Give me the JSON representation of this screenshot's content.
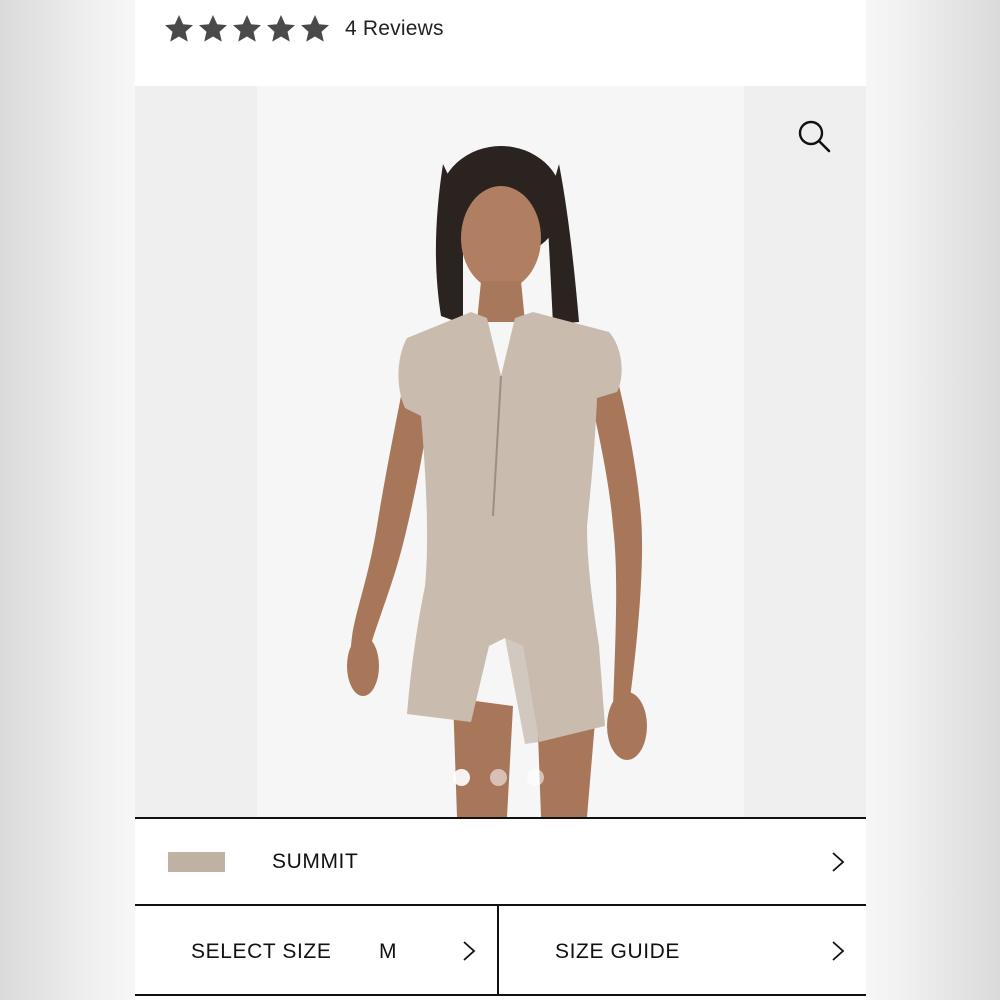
{
  "rating": {
    "stars": 5,
    "reviews_label": "4 Reviews"
  },
  "gallery": {
    "zoom_icon": "search-icon",
    "dot_count": 3,
    "active_dot": 1
  },
  "colour": {
    "label": "SUMMIT",
    "swatch_color": "#bfb2a3"
  },
  "size": {
    "label": "SELECT SIZE",
    "value": "M"
  },
  "size_guide": {
    "label": "SIZE GUIDE"
  }
}
